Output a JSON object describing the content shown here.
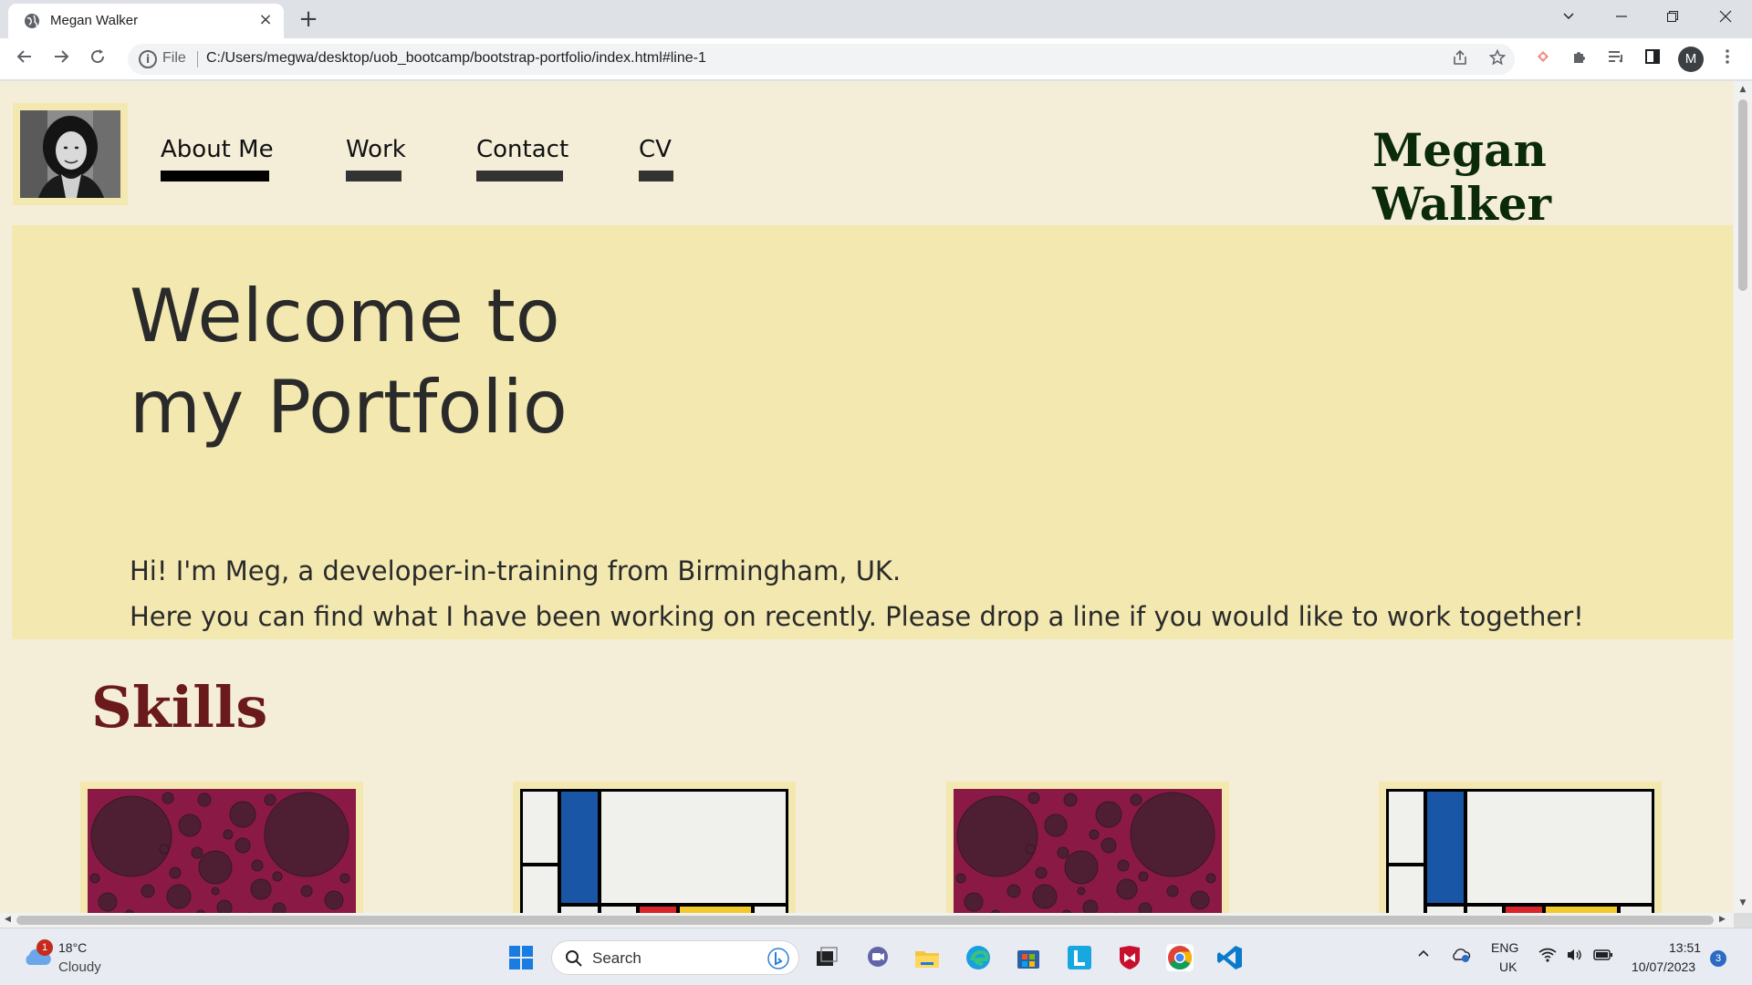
{
  "browser": {
    "tab_title": "Megan Walker",
    "tab_close": "×",
    "new_tab": "+",
    "url_scheme": "File",
    "url": "C:/Users/megwa/desktop/uob_bootcamp/bootstrap-portfolio/index.html#line-1",
    "profile_initial": "M",
    "window_controls": [
      "chevron-down-icon",
      "minimize-icon",
      "restore-icon",
      "close-icon"
    ]
  },
  "site": {
    "name": "Megan Walker",
    "nav": [
      {
        "label": "About Me",
        "active": true
      },
      {
        "label": "Work",
        "active": false
      },
      {
        "label": "Contact",
        "active": false
      },
      {
        "label": "CV",
        "active": false
      }
    ]
  },
  "hero": {
    "title_line1": "Welcome to",
    "title_line2": "my Portfolio",
    "intro_line1": "Hi! I'm Meg, a developer-in-training from Birmingham, UK.",
    "intro_line2": "Here you can find what I have been working on recently. Please drop a line if you would like to work together!"
  },
  "skills": {
    "heading": "Skills",
    "cards": [
      "bubbles-artwork",
      "mondrian-artwork",
      "bubbles-artwork",
      "mondrian-artwork"
    ]
  },
  "colors": {
    "page_bg": "#f4eed8",
    "hero_bg": "#f2e8b0",
    "site_name": "#0a2a0a",
    "skills_heading": "#6a1a1a",
    "bubble_bg": "#8a1a45",
    "bubble_dark": "#4e1f33",
    "mondrian_blue": "#1a56a6",
    "mondrian_red": "#d7262a",
    "mondrian_yellow": "#f2c92c"
  },
  "taskbar": {
    "weather_temp": "18°C",
    "weather_condition": "Cloudy",
    "weather_badge": "1",
    "search_placeholder": "Search",
    "language_line1": "ENG",
    "language_line2": "UK",
    "time": "13:51",
    "date": "10/07/2023",
    "notification_count": "3"
  }
}
